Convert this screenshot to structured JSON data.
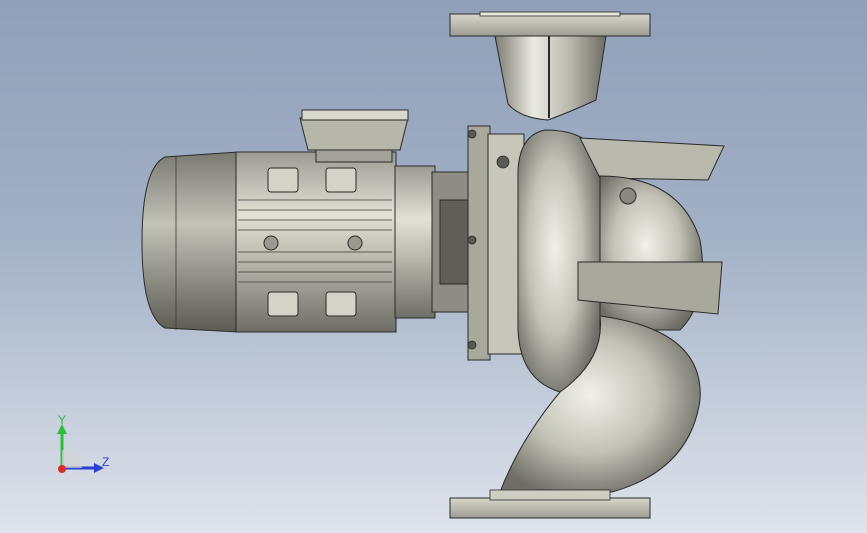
{
  "scene": {
    "background_top": "#8fa0b8",
    "background_bottom": "#dfe3ea",
    "model": "pump-motor-assembly",
    "metal_color": "#c9c8bb",
    "edge_color": "#2a2a2a"
  },
  "triad": {
    "y_label": "Y",
    "z_label": "Z",
    "y_color": "#2bbf3a",
    "z_color": "#2b3fd6",
    "x_color": "#d62b2b"
  }
}
